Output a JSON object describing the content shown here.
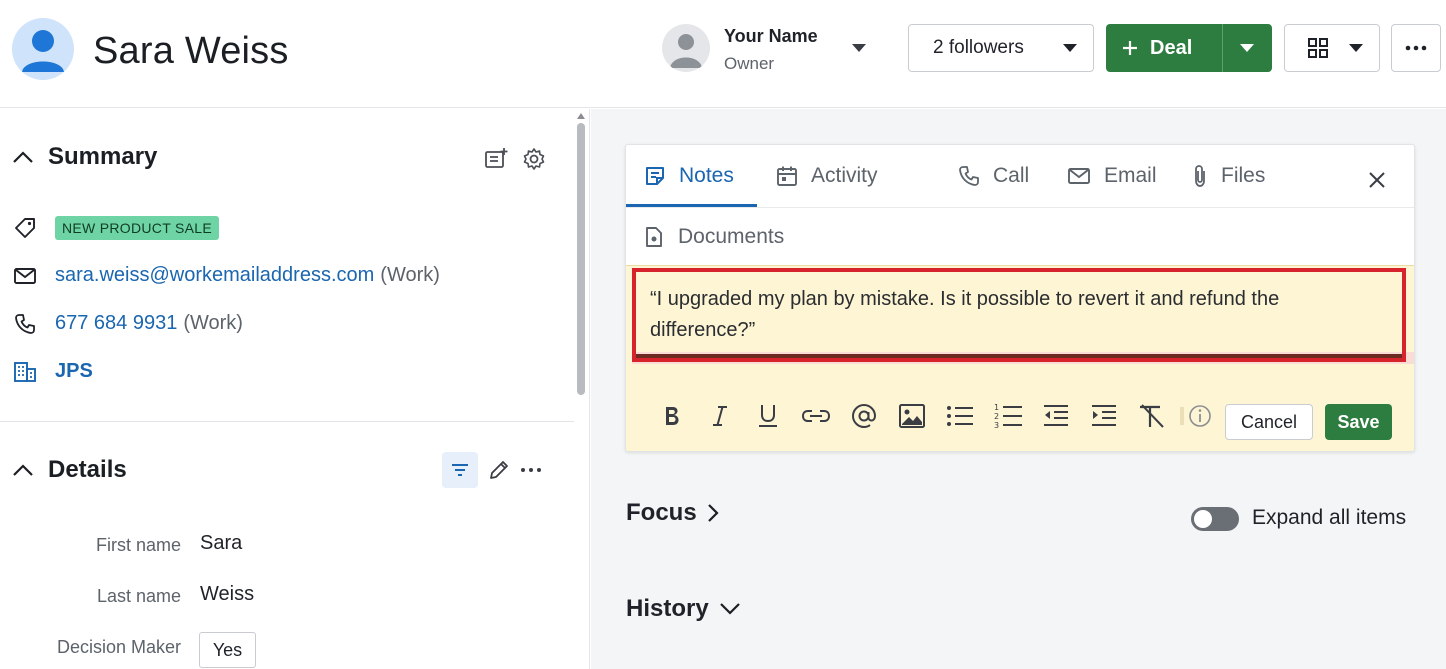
{
  "header": {
    "person_name": "Sara Weiss",
    "owner_name": "Your Name",
    "owner_role": "Owner",
    "followers_label": "2 followers",
    "deal_label": "Deal"
  },
  "summary": {
    "title": "Summary",
    "tag": "NEW PRODUCT SALE",
    "email": "sara.weiss@workemailaddress.com",
    "email_type": "(Work)",
    "phone": "677 684 9931",
    "phone_type": "(Work)",
    "company": "JPS"
  },
  "details": {
    "title": "Details",
    "fields": [
      {
        "label": "First name",
        "value": "Sara"
      },
      {
        "label": "Last name",
        "value": "Weiss"
      },
      {
        "label": "Decision Maker",
        "value": "Yes"
      }
    ]
  },
  "composer": {
    "tabs": [
      {
        "label": "Notes",
        "icon": "notes-icon",
        "active": true
      },
      {
        "label": "Activity",
        "icon": "calendar-icon",
        "active": false
      },
      {
        "label": "Call",
        "icon": "phone-icon",
        "active": false
      },
      {
        "label": "Email",
        "icon": "mail-icon",
        "active": false
      },
      {
        "label": "Files",
        "icon": "paperclip-icon",
        "active": false
      },
      {
        "label": "Documents",
        "icon": "document-icon",
        "active": false
      }
    ],
    "note_text": "“I upgraded my plan by mistake. Is it possible to revert it and refund the difference?”",
    "cancel_label": "Cancel",
    "save_label": "Save"
  },
  "feed": {
    "focus_label": "Focus",
    "history_label": "History",
    "expand_label": "Expand all items",
    "expand_on": false
  },
  "colors": {
    "primary_green": "#2e7d40",
    "link_blue": "#1a66b0",
    "tag_green": "#6fd4a5",
    "editor_bg": "#fdf5d3",
    "highlight_red": "#d7232b"
  }
}
